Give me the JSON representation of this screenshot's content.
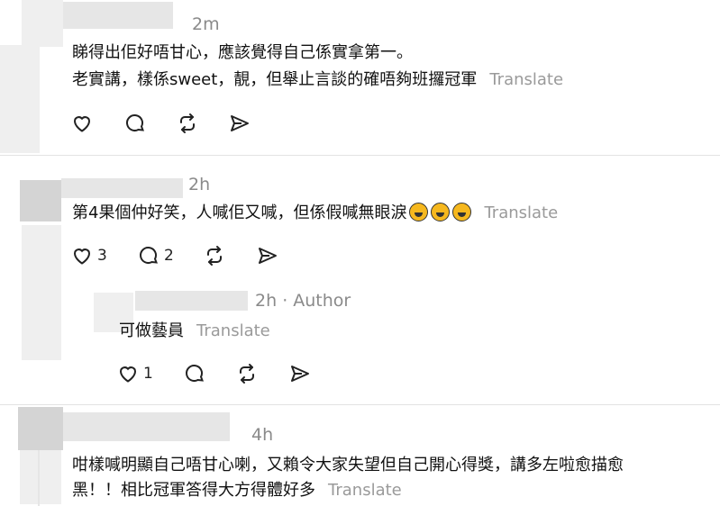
{
  "comments": [
    {
      "time": "2m",
      "line1": "睇得出佢好唔甘心，應該覺得自己係實拿第一。",
      "line2": "老實講，樣係sweet，靚，但舉止言談的確唔夠班攞冠軍",
      "translate": "Translate"
    },
    {
      "time": "2h",
      "text": "第4果個仲好笑，人喊佢又喊，但係假喊無眼淚",
      "translate": "Translate",
      "likes": "3",
      "replies": "2"
    },
    {
      "time": "2h",
      "author_tag": "· Author",
      "text": "可做藝員",
      "translate": "Translate",
      "likes": "1"
    },
    {
      "time": "4h",
      "line1": "咁樣喊明顯自己唔甘心喇，又賴令大家失望但自己開心得獎，講多左啦愈描愈",
      "line2": "黑！！相比冠軍答得大方得體好多",
      "translate": "Translate"
    }
  ],
  "icons": {
    "like": "heart-icon",
    "reply": "comment-icon",
    "repost": "repost-icon",
    "share": "send-icon",
    "emoji": "rolling-laughing-emoji"
  }
}
